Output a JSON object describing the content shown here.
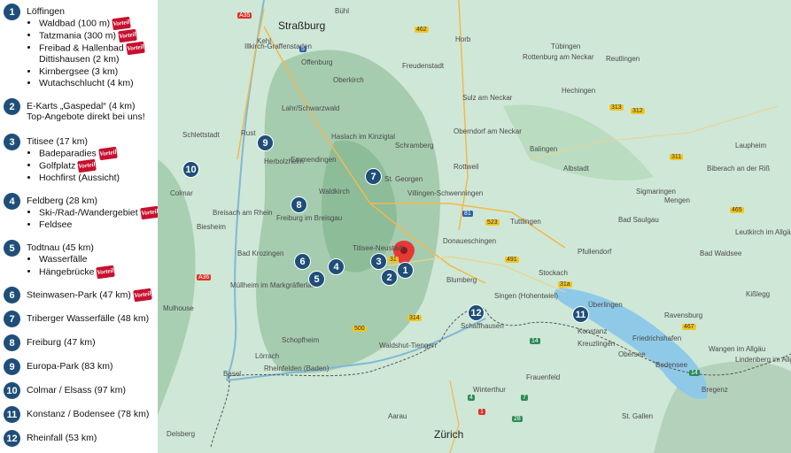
{
  "legend": [
    {
      "num": "1",
      "title": "Löffingen",
      "items": [
        {
          "text": "Waldbad (100 m)",
          "badge": true
        },
        {
          "text": "Tatzmania (300 m)",
          "badge": true
        },
        {
          "text": "Freibad & Hallenbad",
          "badge": true
        },
        {
          "text": "Dittishausen (2 km)",
          "badge": false,
          "continuation": true
        },
        {
          "text": "Kirnbergsee (3 km)",
          "badge": false
        },
        {
          "text": "Wutachschlucht (4 km)",
          "badge": false
        }
      ]
    },
    {
      "num": "2",
      "title": "E-Karts „Gaspedal“ (4 km)",
      "subtitle": "Top-Angebote direkt bei uns!",
      "items": []
    },
    {
      "num": "3",
      "title": "Titisee (17 km)",
      "items": [
        {
          "text": "Badeparadies",
          "badge": true
        },
        {
          "text": "Golfplatz",
          "badge": true
        },
        {
          "text": "Hochfirst (Aussicht)",
          "badge": false
        }
      ]
    },
    {
      "num": "4",
      "title": "Feldberg (28 km)",
      "items": [
        {
          "text": "Ski-/Rad-/Wandergebiet",
          "badge": true
        },
        {
          "text": "Feldsee",
          "badge": false
        }
      ]
    },
    {
      "num": "5",
      "title": "Todtnau (45 km)",
      "items": [
        {
          "text": "Wasserfälle",
          "badge": false
        },
        {
          "text": "Hängebrücke",
          "badge": true
        }
      ]
    },
    {
      "num": "6",
      "title": "Steinwasen-Park (47 km)",
      "badge": true,
      "items": []
    },
    {
      "num": "7",
      "title": "Triberger Wasserfälle (48 km)",
      "items": []
    },
    {
      "num": "8",
      "title": "Freiburg (47 km)",
      "items": []
    },
    {
      "num": "9",
      "title": "Europa-Park (83 km)",
      "items": []
    },
    {
      "num": "10",
      "title": "Colmar / Elsass (97 km)",
      "items": []
    },
    {
      "num": "11",
      "title": "Konstanz / Bodensee (78 km)",
      "items": []
    },
    {
      "num": "12",
      "title": "Rheinfall (53 km)",
      "items": []
    }
  ],
  "badge_text": "Vorteil",
  "map": {
    "places": [
      "Straßburg",
      "Offenburg",
      "Lahr/Schwarzwald",
      "Emmendingen",
      "Waldkirch",
      "Freiburg im Breisgau",
      "Colmar",
      "Breisach am Rhein",
      "Bad Krozingen",
      "Müllheim im Markgräflerland",
      "Mulhouse",
      "Schopfheim",
      "Lörrach",
      "Basel",
      "Rheinfelden (Baden)",
      "Waldshut-Tiengen",
      "Titisee-Neustadt",
      "Donaueschingen",
      "Villingen-Schwenningen",
      "St. Georgen",
      "Schramberg",
      "Rottweil",
      "Freudenstadt",
      "Tübingen",
      "Rottenburg am Neckar",
      "Sulz am Neckar",
      "Oberndorf am Neckar",
      "Balingen",
      "Albstadt",
      "Tuttlingen",
      "Stockach",
      "Singen (Hohentwiel)",
      "Schaffhausen",
      "Winterthur",
      "Zürich",
      "Konstanz",
      "Kreuzlingen",
      "Überlingen",
      "Friedrichshafen",
      "Ravensburg",
      "Bregenz",
      "St. Gallen",
      "Frauenfeld",
      "Bad Saulgau",
      "Bad Waldsee",
      "Biberach an der Riß",
      "Laupheim",
      "Reutlingen",
      "Pfullendorf",
      "Bodensee",
      "Obersee",
      "Oberkirch",
      "Kehl",
      "Rust",
      "Illkirch-Graffenstaden",
      "Haslach im Kinzigtal",
      "Blumberg",
      "Hechingen",
      "Sigmaringen",
      "Wangen im Allgäu",
      "Kißlegg",
      "Leutkirch im Allgäu",
      "Lindenberg im Allgäu",
      "Delsberg",
      "Schlettstadt",
      "Herbolzheim",
      "Bühl",
      "Horb",
      "Mengen",
      "Biesheim",
      "Aarau"
    ],
    "markers": [
      {
        "num": "1"
      },
      {
        "num": "2"
      },
      {
        "num": "3"
      },
      {
        "num": "4"
      },
      {
        "num": "5"
      },
      {
        "num": "6"
      },
      {
        "num": "7"
      },
      {
        "num": "8"
      },
      {
        "num": "9"
      },
      {
        "num": "10"
      },
      {
        "num": "11"
      },
      {
        "num": "12"
      }
    ],
    "roads": [
      "A35",
      "5",
      "462",
      "81",
      "523",
      "31",
      "500",
      "A36",
      "314",
      "491",
      "31a",
      "313",
      "312",
      "311",
      "465",
      "467",
      "14",
      "1",
      "4",
      "7",
      "28",
      "14"
    ],
    "colors": {
      "land": "#cfe7d6",
      "forest": "#9fc7a8",
      "water": "#8fc9e8",
      "marker": "#1f4e79",
      "pin": "#e53935"
    }
  }
}
